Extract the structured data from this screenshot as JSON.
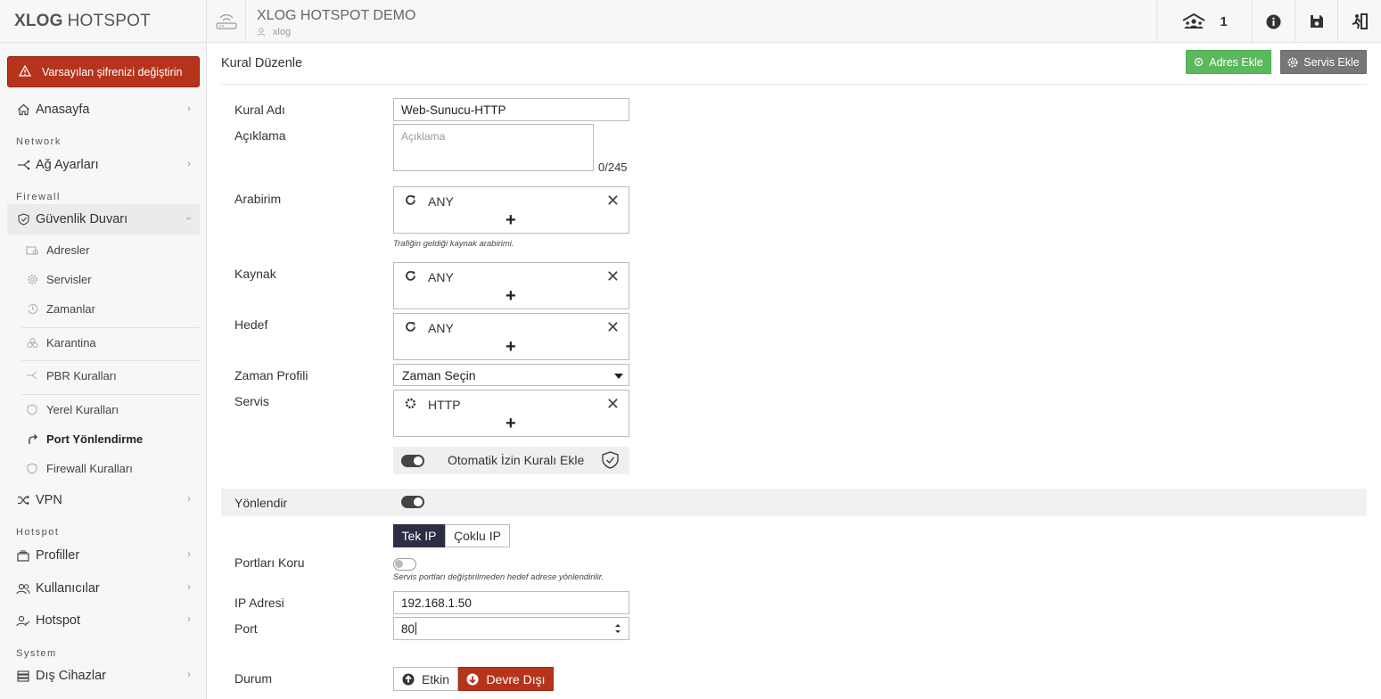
{
  "brand": {
    "bold": "XLOG",
    "light": "HOTSPOT"
  },
  "alert": {
    "text": "Varsayılan şifrenizi değiştirin"
  },
  "sidebar": {
    "home": "Anasayfa",
    "sections": {
      "network": "Network",
      "firewall": "Firewall",
      "hotspot": "Hotspot",
      "system": "System"
    },
    "network_settings": "Ağ Ayarları",
    "firewall_group": "Güvenlik Duvarı",
    "firewall_items": [
      "Adresler",
      "Servisler",
      "Zamanlar",
      "Karantina",
      "PBR Kuralları",
      "Yerel Kuralları",
      "Port Yönlendirme",
      "Firewall Kuralları"
    ],
    "vpn": "VPN",
    "profiles": "Profiller",
    "users": "Kullanıcılar",
    "hotspot": "Hotspot",
    "external_devices": "Dış Cihazlar"
  },
  "header": {
    "title": "XLOG HOTSPOT DEMO",
    "subtitle": "xlog",
    "online_count": "1"
  },
  "page": {
    "title": "Kural Düzenle",
    "add_address": "Adres Ekle",
    "add_service": "Servis Ekle"
  },
  "form": {
    "rule_name_label": "Kural Adı",
    "rule_name_value": "Web-Sunucu-HTTP",
    "description_label": "Açıklama",
    "description_placeholder": "Açıklama",
    "description_counter": "0/245",
    "interface_label": "Arabirim",
    "interface_value": "ANY",
    "interface_hint": "Trafiğin geldiği kaynak arabirimi.",
    "source_label": "Kaynak",
    "source_value": "ANY",
    "destination_label": "Hedef",
    "destination_value": "ANY",
    "time_profile_label": "Zaman Profili",
    "time_profile_value": "Zaman Seçin",
    "service_label": "Servis",
    "service_value": "HTTP",
    "auto_rule_label": "Otomatik İzin Kuralı Ekle",
    "redirect_label": "Yönlendir",
    "mode_single": "Tek IP",
    "mode_multi": "Çoklu IP",
    "preserve_ports_label": "Portları Koru",
    "preserve_ports_hint": "Servis portları değiştirilmeden hedef adrese yönlendirilir.",
    "ip_label": "IP Adresi",
    "ip_value": "192.168.1.50",
    "port_label": "Port",
    "port_value": "80",
    "status_label": "Durum",
    "status_enabled": "Etkin",
    "status_disabled": "Devre Dışı"
  },
  "colors": {
    "alert": "#b5341b",
    "green": "#5cb85c",
    "segment_active": "#2d2d45"
  }
}
